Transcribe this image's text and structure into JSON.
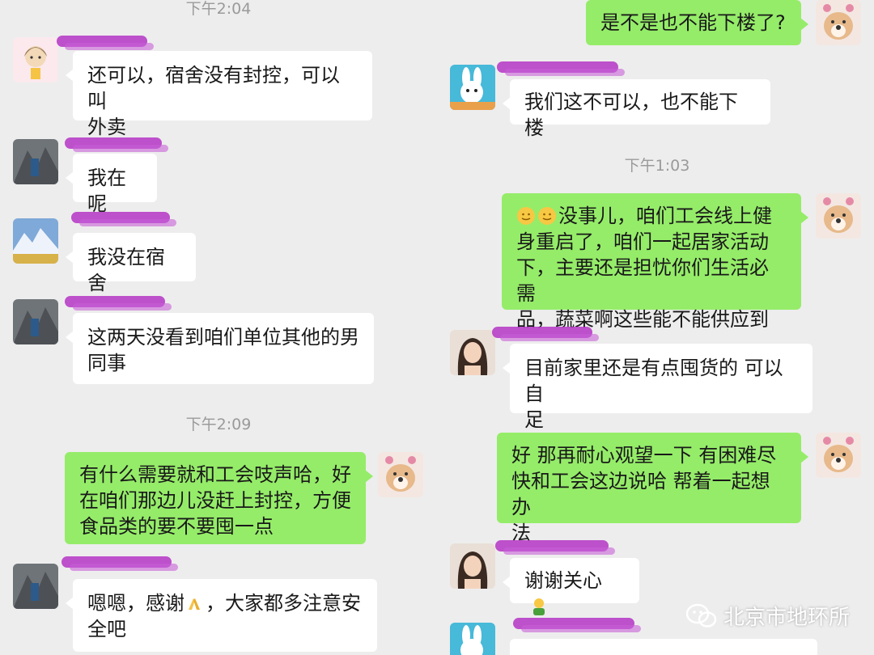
{
  "left": {
    "timestamps": {
      "t1": "下午2:04",
      "t2": "下午2:09"
    },
    "messages": {
      "m1": "还可以，宿舍没有封控，可以叫\n外卖",
      "m2": "我在呢",
      "m3": "我没在宿舍",
      "m4": "这两天没看到咱们单位其他的男\n同事",
      "m5": "有什么需要就和工会吱声哈，好\n在咱们那边儿没赶上封控，方便\n食品类的要不要囤一点",
      "m6a": "嗯嗯，感谢",
      "m6b": "，大家都多注意安\n全吧"
    }
  },
  "right": {
    "timestamps": {
      "t1": "下午1:03"
    },
    "messages": {
      "r1": "是不是也不能下楼了?",
      "r2": "我们这不可以，也不能下楼",
      "r3": "没事儿，咱们工会线上健\n身重启了，咱们一起居家活动\n下，主要还是担忧你们生活必需\n品，蔬菜啊这些能不能供应到",
      "r4": "目前家里还是有点囤货的 可以自\n足",
      "r5": "好 那再耐心观望一下 有困难尽\n快和工会这边说哈 帮着一起想办\n法",
      "r6": "谢谢关心"
    }
  },
  "watermark": {
    "text": "北京市地环所"
  },
  "colors": {
    "outgoing": "#95ec69",
    "incoming": "#ffffff",
    "background": "#ededed",
    "name_redaction": "#b535c6"
  },
  "icons": [
    "cartoon-girl-avatar",
    "dog-avatar",
    "mountain-avatar",
    "snow-scene-avatar",
    "rabbit-avatar",
    "woman-avatar",
    "hug-emoji",
    "pray-hands-emoji",
    "muscle-emoji",
    "wechat-logo"
  ]
}
